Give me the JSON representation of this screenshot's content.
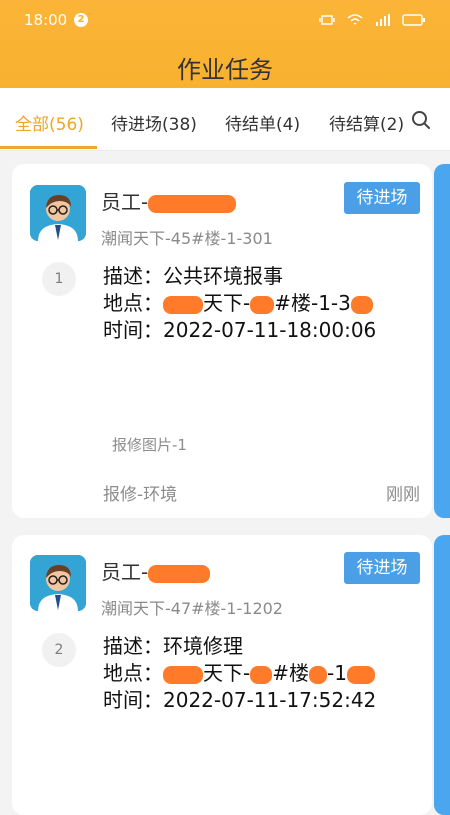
{
  "status_bar": {
    "time": "18:00",
    "notification_count": "2"
  },
  "page": {
    "title": "作业任务"
  },
  "tabs": [
    {
      "label": "全部(56)"
    },
    {
      "label": "待进场(38)"
    },
    {
      "label": "待结单(4)"
    },
    {
      "label": "待结算(2)"
    }
  ],
  "tasks": [
    {
      "employee": "员工-",
      "location": "潮闻天下-45#楼-1-301",
      "status": "待进场",
      "index": "1",
      "description_label": "描述：",
      "description": "公共环境报事",
      "address_label": "地点：",
      "address_middle": "天下-",
      "address_tail": "#楼-1-3",
      "time_label": "时间：",
      "time": "2022-07-11-18:00:06",
      "photo": "报修图片-1",
      "category": "报修-环境",
      "relative_time": "刚刚"
    },
    {
      "employee": "员工-",
      "location": "潮闻天下-47#楼-1-1202",
      "status": "待进场",
      "index": "2",
      "description_label": "描述：",
      "description": "环境修理",
      "address_label": "地点：",
      "address_middle": "天下-",
      "address_mid2": "#楼",
      "address_tail": "-1",
      "time_label": "时间：",
      "time": "2022-07-11-17:52:42"
    }
  ],
  "colors": {
    "header": "#f8b12f",
    "active_tab": "#f1a526",
    "status_button": "#4a9fe6",
    "redaction": "#ff7b2a"
  },
  "icons": [
    "search-icon",
    "avatar",
    "wifi-icon",
    "signal-icon",
    "battery-icon"
  ]
}
